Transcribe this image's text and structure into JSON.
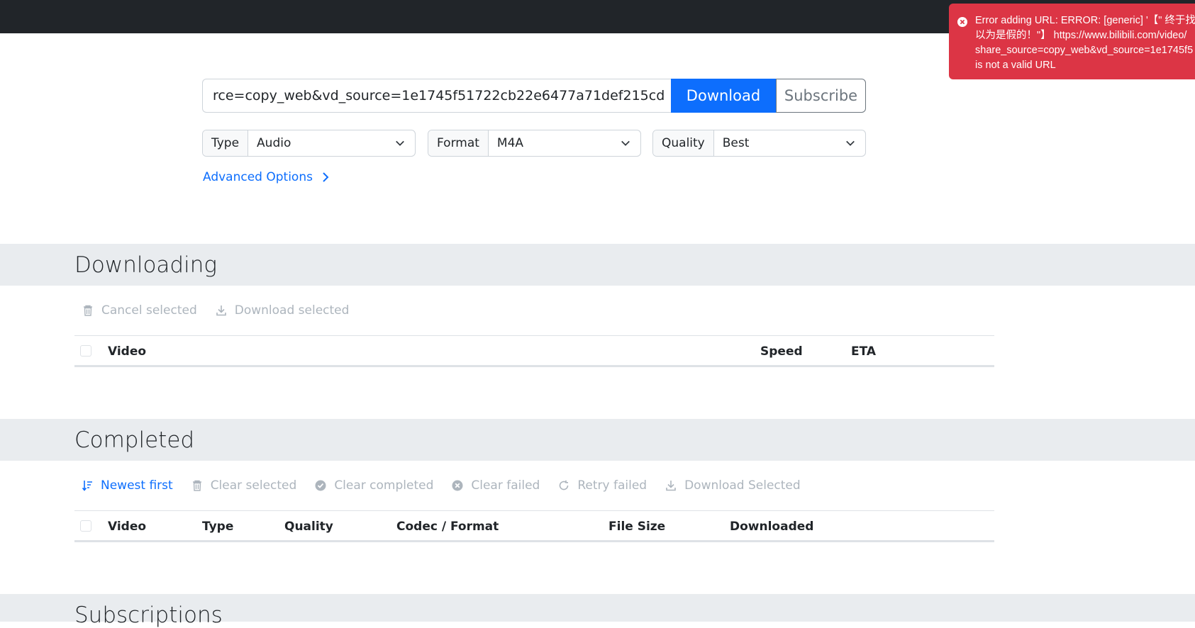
{
  "url_bar": {
    "value": "rce=copy_web&vd_source=1e1745f51722cb22e6477a71def215cd",
    "download_label": "Download",
    "subscribe_label": "Subscribe"
  },
  "options": {
    "type": {
      "label": "Type",
      "value": "Audio"
    },
    "format": {
      "label": "Format",
      "value": "M4A"
    },
    "quality": {
      "label": "Quality",
      "value": "Best"
    },
    "advanced_label": "Advanced Options"
  },
  "downloading": {
    "title": "Downloading",
    "actions": {
      "cancel": "Cancel selected",
      "download": "Download selected"
    },
    "columns": {
      "video": "Video",
      "speed": "Speed",
      "eta": "ETA"
    }
  },
  "completed": {
    "title": "Completed",
    "actions": {
      "newest": "Newest first",
      "clear_selected": "Clear selected",
      "clear_completed": "Clear completed",
      "clear_failed": "Clear failed",
      "retry_failed": "Retry failed",
      "download_selected": "Download Selected"
    },
    "columns": {
      "video": "Video",
      "type": "Type",
      "quality": "Quality",
      "codec": "Codec / Format",
      "size": "File Size",
      "downloaded": "Downloaded"
    }
  },
  "subscriptions": {
    "title": "Subscriptions"
  },
  "toast": {
    "line1": "Error adding URL: ERROR: [generic] '【\" 终于找",
    "line2": "以为是假的！\"】 https://www.bilibili.com/video/",
    "line3": "share_source=copy_web&vd_source=1e1745f5",
    "line4": "is not a valid URL"
  },
  "colors": {
    "primary": "#0d6efd",
    "danger": "#dc3545",
    "topbar": "#212529",
    "section_bg": "#e9ecef",
    "muted": "#adb5bd"
  }
}
